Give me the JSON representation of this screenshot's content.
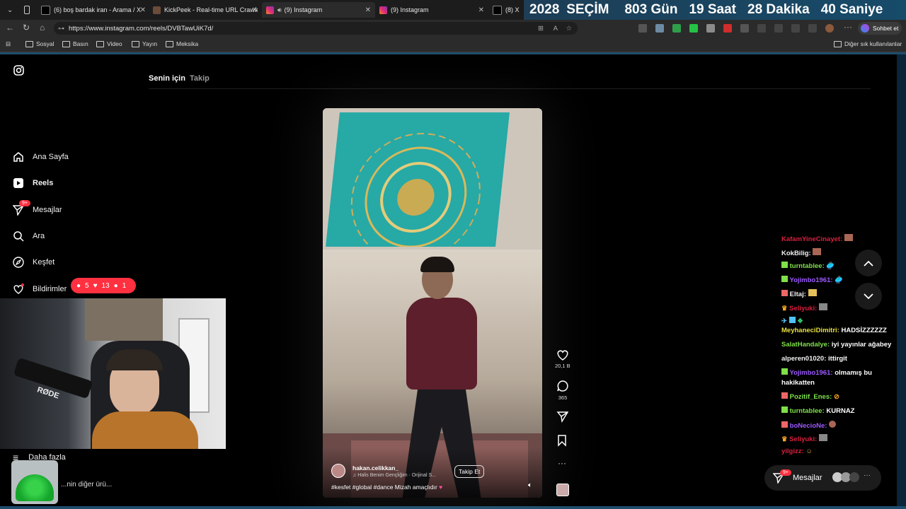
{
  "browser": {
    "tabs": [
      {
        "title": "(6) boş bardak iran - Arama / X",
        "icon": "x-icon"
      },
      {
        "title": "KickPeek - Real-time URL Crawler",
        "icon": "kickpeek-icon"
      },
      {
        "title": "(9) Instagram",
        "icon": "instagram-icon",
        "active": true
      },
      {
        "title": "(9) Instagram",
        "icon": "instagram-icon"
      },
      {
        "title": "(8) X'te A",
        "icon": "x-icon"
      }
    ],
    "url": "https://www.instagram.com/reels/DVBTawUiK7d/",
    "chat_button": "Sohbet et",
    "bookmarks": [
      "Sosyal",
      "Basın",
      "Video",
      "Yayın",
      "Meksika"
    ],
    "other_bookmarks": "Diğer sık kullanılanlar"
  },
  "countdown": {
    "year": "2028",
    "label": "SEÇİM",
    "days": "803 Gün",
    "hours": "19 Saat",
    "minutes": "28 Dakika",
    "seconds": "40 Saniye"
  },
  "instagram": {
    "feed_tabs": [
      "Senin için",
      "Takip"
    ],
    "nav": [
      {
        "label": "Ana Sayfa",
        "icon": "home-icon"
      },
      {
        "label": "Reels",
        "icon": "reels-icon",
        "active": true
      },
      {
        "label": "Mesajlar",
        "icon": "messages-icon",
        "badge": "9+"
      },
      {
        "label": "Ara",
        "icon": "search-icon"
      },
      {
        "label": "Keşfet",
        "icon": "explore-icon"
      },
      {
        "label": "Bildirimler",
        "icon": "heart-icon"
      }
    ],
    "more": "Daha fazla",
    "other": "...nin diğer ürü...",
    "notif_pill": {
      "comments": "5",
      "likes": "13",
      "follows": "1"
    },
    "reel": {
      "author": "hakan.celikkan_",
      "audio": "Halis Benim Gençliğim · Orijinal S...",
      "follow": "Takip Et",
      "caption": "#kesfet #global #dance Mizah amaçlıdır",
      "likes": "20,1 B",
      "comments": "365"
    },
    "messages_pill": {
      "label": "Mesajlar",
      "badge": "9+"
    }
  },
  "stream_chat": [
    {
      "user": "KafamYineCinayet:",
      "msg": "",
      "color": "#d9203f"
    },
    {
      "user": "KokBilig:",
      "msg": "",
      "color": "#f2f2f2"
    },
    {
      "user": "turntablee:",
      "msg": "",
      "color": "#7fe04a"
    },
    {
      "user": "Yojimbo1961:",
      "msg": "",
      "color": "#9b59ff"
    },
    {
      "user": "Eltaj:",
      "msg": "",
      "color": "#f2f2f2"
    },
    {
      "user": "Seliyuki:",
      "msg": "",
      "color": "#d9203f"
    },
    {
      "user": "",
      "msg": "",
      "color": "#f2f2f2"
    },
    {
      "user": "MeyhaneciDimitri:",
      "msg": "HADSİZZZZZZ",
      "color": "#e8e040"
    },
    {
      "user": "SalatHandalye:",
      "msg": "iyi yayınlar ağabey",
      "color": "#7fe04a"
    },
    {
      "user": "alperen01020:",
      "msg": "ittirgit",
      "color": "#f2f2f2"
    },
    {
      "user": "Yojimbo1961:",
      "msg": "olmamış bu",
      "color": "#9b59ff"
    },
    {
      "user": "",
      "msg": "hakikatten",
      "color": "#f2f2f2"
    },
    {
      "user": "Pozitif_Enes:",
      "msg": "",
      "color": "#7fe04a"
    },
    {
      "user": "turntablee:",
      "msg": "KURNAZ",
      "color": "#7fe04a"
    },
    {
      "user": "boNecioNe:",
      "msg": "",
      "color": "#9b59ff"
    },
    {
      "user": "Seliyuki:",
      "msg": "",
      "color": "#d9203f"
    },
    {
      "user": "yilgizz:",
      "msg": "",
      "color": "#d9203f"
    }
  ]
}
